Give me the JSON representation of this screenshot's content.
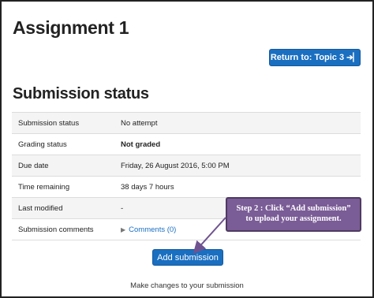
{
  "page": {
    "title": "Assignment 1",
    "return_button": {
      "label": "Return to: Topic 3",
      "icon": "sign-in-icon"
    },
    "section_title": "Submission status"
  },
  "status_table": {
    "rows": [
      {
        "label": "Submission status",
        "value": "No attempt"
      },
      {
        "label": "Grading status",
        "value": "Not graded"
      },
      {
        "label": "Due date",
        "value": "Friday, 26 August 2016, 5:00 PM"
      },
      {
        "label": "Time remaining",
        "value": "38 days 7 hours"
      },
      {
        "label": "Last modified",
        "value": "-"
      },
      {
        "label": "Submission comments",
        "value": "Comments (0)"
      }
    ]
  },
  "actions": {
    "add_submission_label": "Add submission",
    "hint": "Make changes to your submission"
  },
  "callout": {
    "line1": "Step 2 : Click “Add submission”",
    "line2": "to upload your assignment."
  },
  "colors": {
    "button_blue": "#1a6fc1",
    "callout_purple": "#7a5c96",
    "table_stripe": "#f4f4f4"
  }
}
